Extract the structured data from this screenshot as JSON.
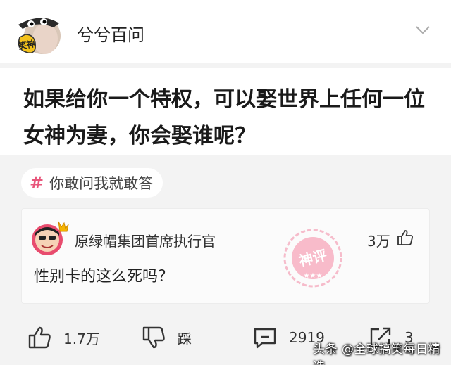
{
  "header": {
    "avatar_text": "笑神",
    "author": "兮兮百问",
    "expand_icon": "chevron-down-icon"
  },
  "question": {
    "title": "如果给你一个特权，可以娶世界上任何一位女神为妻，你会娶谁呢？"
  },
  "topic": {
    "icon": "hash-icon",
    "label": "你敢问我就敢答"
  },
  "comment": {
    "user": "原绿帽集团首席执行官",
    "likes": "3万",
    "text": "性别卡的这么死吗？",
    "stamp_text": "神评"
  },
  "actions": {
    "upvote": "1.7万",
    "downvote": "踩",
    "comments": "2919",
    "shares": "3"
  },
  "watermark": "头条 @全球搞笑每日精选",
  "colors": {
    "accent": "#e8567b",
    "stamp": "#f08aa0"
  }
}
